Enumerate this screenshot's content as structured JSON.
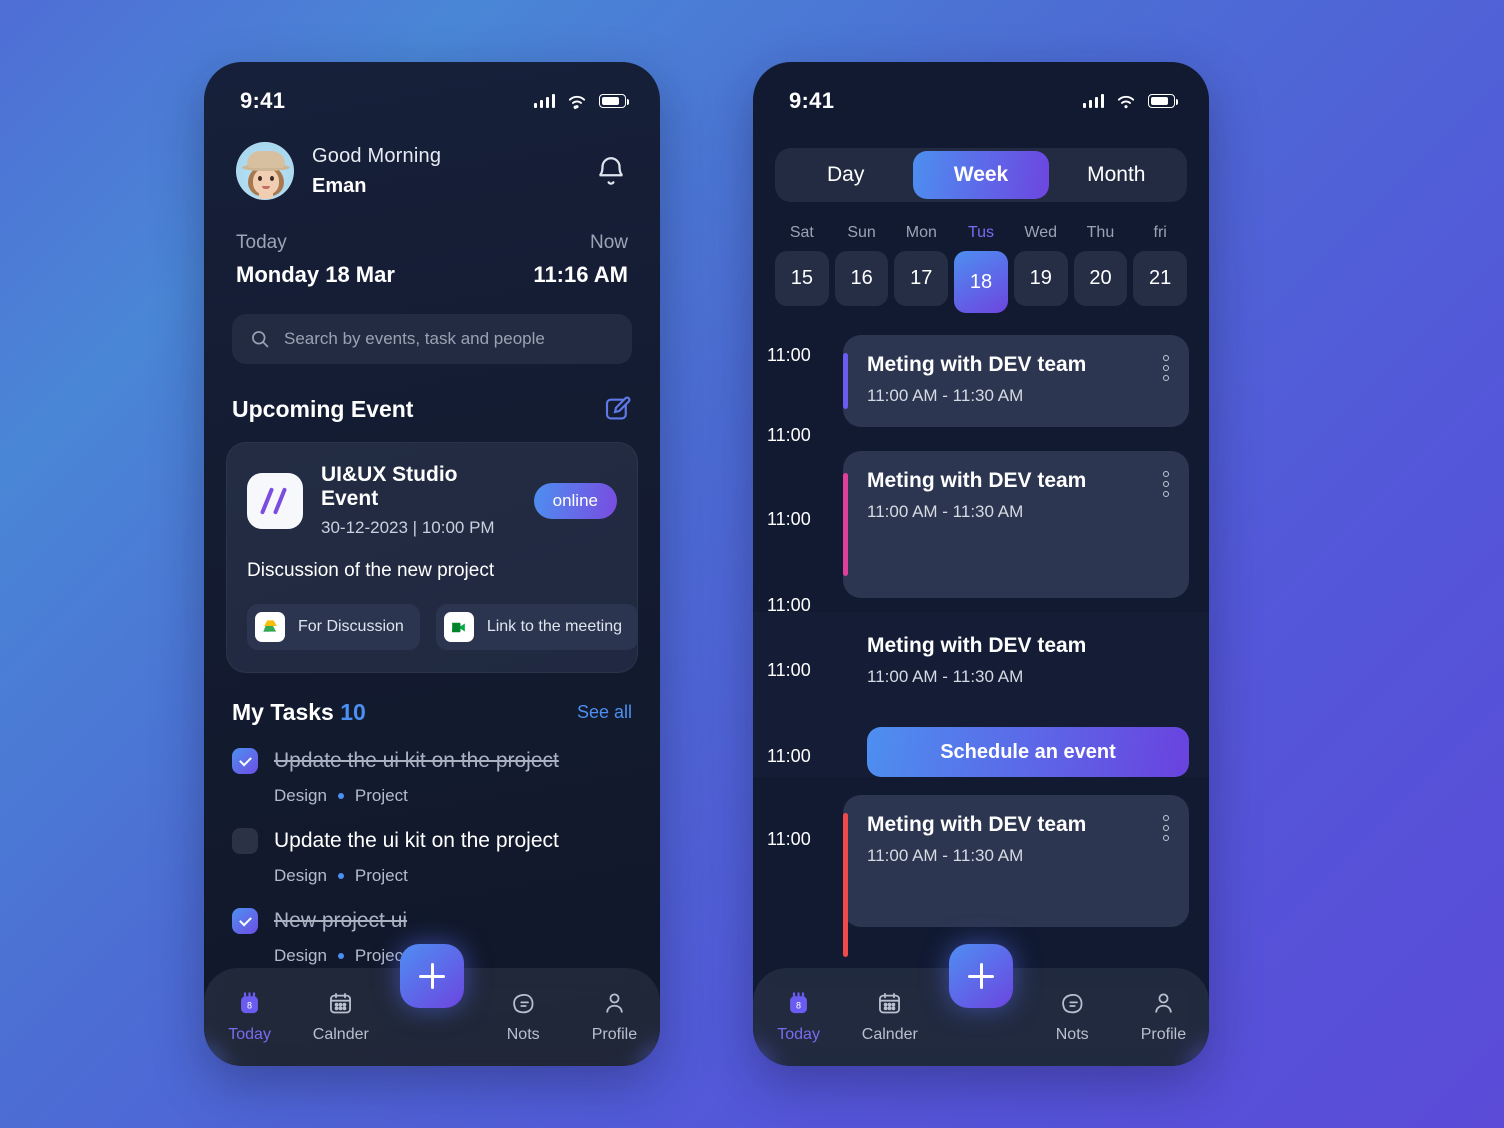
{
  "background": {
    "from": "#4a86d6",
    "to": "#5b4bd8"
  },
  "accent": {
    "blue": "#4d8ff0",
    "purple": "#6d45e0",
    "pink": "#e0409a",
    "red": "#ef4a4a",
    "violet": "#6a5cf0"
  },
  "left_phone": {
    "status": {
      "time": "9:41",
      "signal_icon": "cellular-signal-icon",
      "wifi_icon": "wifi-icon",
      "battery_icon": "battery-icon"
    },
    "greeting": {
      "salutation": "Good Morning",
      "name": "Eman",
      "avatar_name": "user-avatar",
      "bell_icon": "notification-bell-icon"
    },
    "date_row": {
      "today_label": "Today",
      "today_value": "Monday 18 Mar",
      "now_label": "Now",
      "now_value": "11:16 AM"
    },
    "search": {
      "placeholder": "Search by events, task and people",
      "icon": "search-icon"
    },
    "upcoming": {
      "title": "Upcoming Event",
      "edit_icon": "edit-square-icon",
      "event": {
        "logo": "slash-logo-icon",
        "title": "UI&UX Studio Event",
        "date": "30-12-2023 | 10:00 PM",
        "badge": "online",
        "description": "Discussion of the new project",
        "chips": [
          {
            "icon": "google-drive-icon",
            "label": "For Discussion"
          },
          {
            "icon": "google-meet-icon",
            "label": "Link to the meeting"
          }
        ]
      }
    },
    "tasks_section": {
      "title": "My Tasks",
      "count": "10",
      "see_all": "See all",
      "items": [
        {
          "name": "Update the ui kit on the project",
          "checked": true,
          "tag1": "Design",
          "tag2": "Project"
        },
        {
          "name": "Update the ui kit on the project",
          "checked": false,
          "tag1": "Design",
          "tag2": "Project"
        },
        {
          "name": "New project ui",
          "checked": true,
          "tag1": "Design",
          "tag2": "Project"
        }
      ]
    },
    "nav": {
      "fab_icon": "plus-icon",
      "items": [
        {
          "label": "Today",
          "icon": "calendar-today-icon",
          "active": true
        },
        {
          "label": "Calnder",
          "icon": "calendar-icon",
          "active": false
        },
        {
          "label": "Nots",
          "icon": "notes-icon",
          "active": false
        },
        {
          "label": "Profile",
          "icon": "profile-icon",
          "active": false
        }
      ]
    }
  },
  "right_phone": {
    "status": {
      "time": "9:41",
      "signal_icon": "cellular-signal-icon",
      "wifi_icon": "wifi-icon",
      "battery_icon": "battery-icon"
    },
    "view_segments": [
      {
        "label": "Day",
        "active": false
      },
      {
        "label": "Week",
        "active": true
      },
      {
        "label": "Month",
        "active": false
      }
    ],
    "week_days": [
      {
        "day": "Sat",
        "num": "15",
        "selected": false
      },
      {
        "day": "Sun",
        "num": "16",
        "selected": false
      },
      {
        "day": "Mon",
        "num": "17",
        "selected": false
      },
      {
        "day": "Tus",
        "num": "18",
        "selected": true
      },
      {
        "day": "Wed",
        "num": "19",
        "selected": false
      },
      {
        "day": "Thu",
        "num": "20",
        "selected": false
      },
      {
        "day": "fri",
        "num": "21",
        "selected": false
      }
    ],
    "time_labels": [
      "11:00",
      "11:00",
      "11:00",
      "11:00",
      "11:00",
      "11:00"
    ],
    "agenda": [
      {
        "time": "11:00",
        "title": "Meting with DEV team",
        "range": "11:00 AM - 11:30 AM",
        "bar_color": "#6a5cf0",
        "filled": true,
        "menu_icon": "more-vertical-icon",
        "has_button": false
      },
      {
        "time": "11:00",
        "title": "Meting with DEV team",
        "range": "11:00 AM - 11:30 AM",
        "bar_color": "#e0409a",
        "filled": true,
        "menu_icon": "more-vertical-icon",
        "has_button": false
      },
      {
        "time": "11:00",
        "title": "Meting with DEV team",
        "range": "11:00 AM - 11:30 AM",
        "bar_color": "",
        "filled": false,
        "menu_icon": "",
        "has_button": true,
        "button_label": "Schedule an event"
      },
      {
        "time": "11:00",
        "title": "Meting with DEV team",
        "range": "11:00 AM - 11:30 AM",
        "bar_color": "#ef4a4a",
        "filled": true,
        "menu_icon": "more-vertical-icon",
        "has_button": false
      }
    ],
    "nav": {
      "fab_icon": "plus-icon",
      "items": [
        {
          "label": "Today",
          "icon": "calendar-today-icon",
          "active": true
        },
        {
          "label": "Calnder",
          "icon": "calendar-icon",
          "active": false
        },
        {
          "label": "Nots",
          "icon": "notes-icon",
          "active": false
        },
        {
          "label": "Profile",
          "icon": "profile-icon",
          "active": false
        }
      ]
    }
  }
}
